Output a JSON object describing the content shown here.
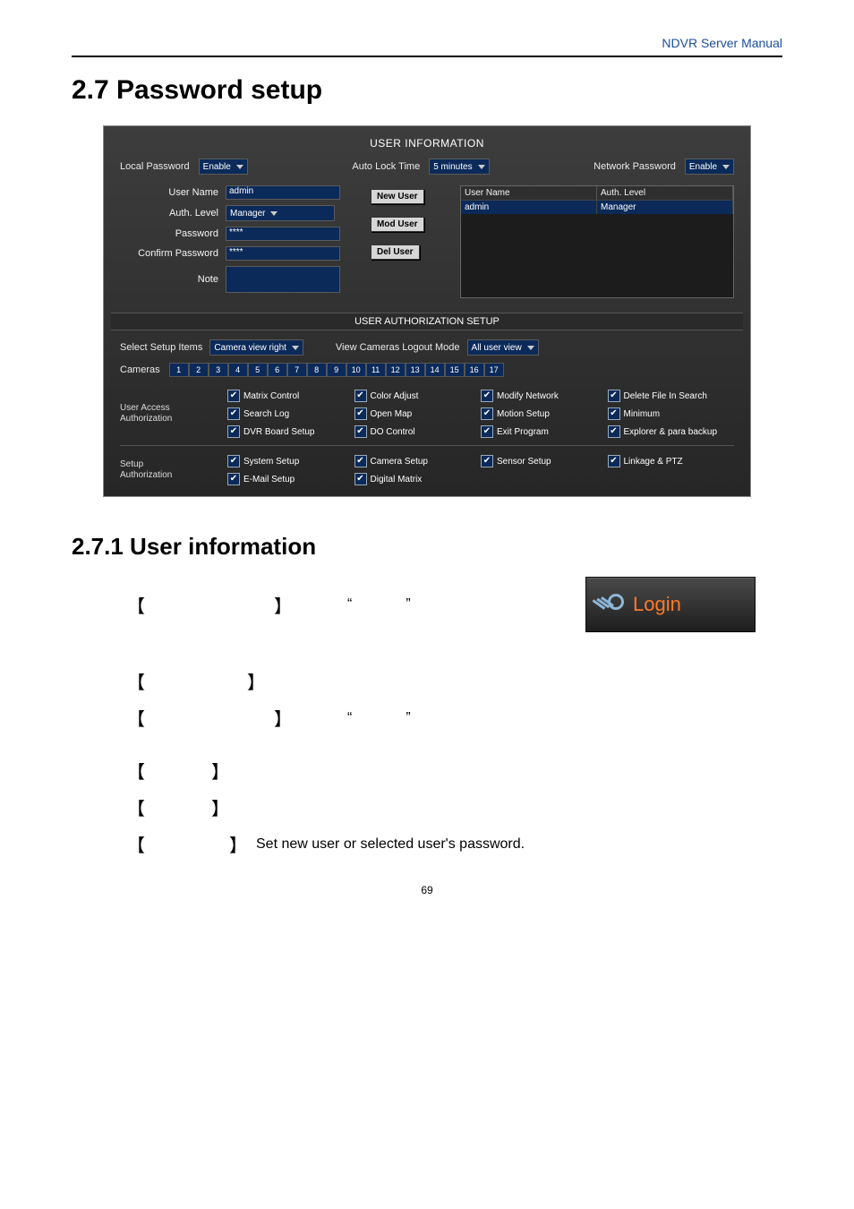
{
  "header": {
    "doc_title": "NDVR Server Manual"
  },
  "section": {
    "title": "2.7 Password setup"
  },
  "subsection": {
    "title": "2.7.1 User information"
  },
  "screenshot": {
    "userinfo_title": "USER INFORMATION",
    "local_password_lbl": "Local Password",
    "local_password_val": "Enable",
    "autolock_lbl": "Auto Lock Time",
    "autolock_val": "5 minutes",
    "net_password_lbl": "Network Password",
    "net_password_val": "Enable",
    "form": {
      "username_lbl": "User Name",
      "username_val": "admin",
      "authlevel_lbl": "Auth. Level",
      "authlevel_val": "Manager",
      "password_lbl": "Password",
      "password_val": "****",
      "confirm_lbl": "Confirm Password",
      "confirm_val": "****",
      "note_lbl": "Note",
      "note_val": ""
    },
    "buttons": {
      "new_user": "New User",
      "mod_user": "Mod User",
      "del_user": "Del User"
    },
    "table": {
      "col1": "User Name",
      "col2": "Auth. Level",
      "row": {
        "c1": "admin",
        "c2": "Manager"
      }
    },
    "auth_title": "USER AUTHORIZATION SETUP",
    "select_setup_lbl": "Select Setup Items",
    "select_setup_val": "Camera view right",
    "view_logout_lbl": "View Cameras Logout Mode",
    "view_logout_val": "All user view",
    "cameras_lbl": "Cameras",
    "cameras": [
      "1",
      "2",
      "3",
      "4",
      "5",
      "6",
      "7",
      "8",
      "9",
      "10",
      "11",
      "12",
      "13",
      "14",
      "15",
      "16",
      "17"
    ],
    "user_access_lbl": "User Access\nAuthorization",
    "setup_auth_lbl": "Setup\nAuthorization",
    "ua": {
      "r1": {
        "c1": "Matrix Control",
        "c2": "Color Adjust",
        "c3": "Modify Network",
        "c4": "Delete File In Search"
      },
      "r2": {
        "c1": "Search Log",
        "c2": "Open Map",
        "c3": "Motion Setup",
        "c4": "Minimum"
      },
      "r3": {
        "c1": "DVR Board Setup",
        "c2": "DO Control",
        "c3": "Exit Program",
        "c4": "Explorer & para backup"
      }
    },
    "sa": {
      "r1": {
        "c1": "System Setup",
        "c2": "Camera Setup",
        "c3": "Sensor Setup",
        "c4": "Linkage & PTZ"
      },
      "r2": {
        "c1": "E-Mail Setup",
        "c2": "Digital Matrix"
      }
    }
  },
  "login_button": {
    "label": "Login"
  },
  "quoted": {
    "a": "“",
    "b": "”"
  },
  "final_line": "Set new user or selected user's password.",
  "page_number": "69"
}
